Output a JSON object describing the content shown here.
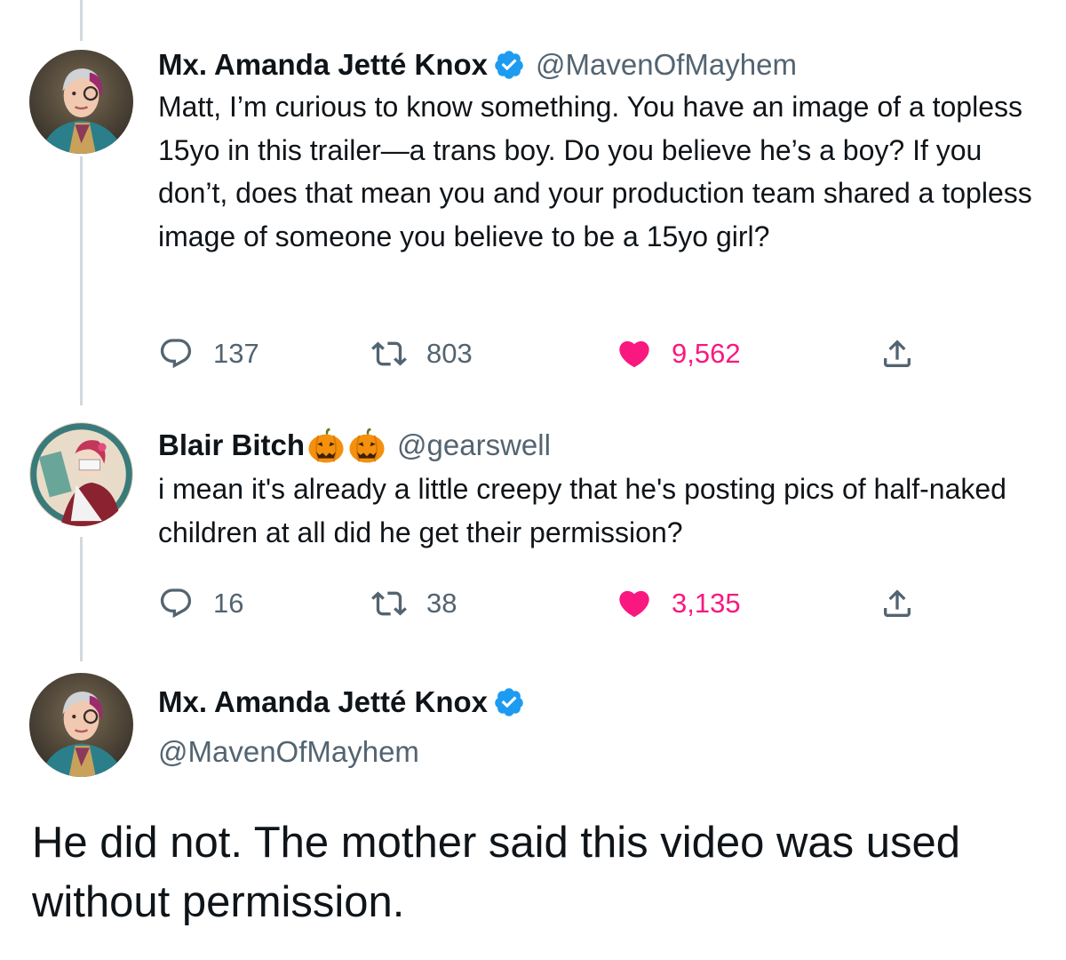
{
  "thread": [
    {
      "author": {
        "display_name": "Mx. Amanda Jetté Knox",
        "handle": "@MavenOfMayhem",
        "verified": true,
        "avatar_icon": "avatar-photo"
      },
      "text": "Matt, I’m curious to know something. You have an image of a topless 15yo in this trailer—a trans boy. Do you believe he’s a boy? If you don’t, does that mean you and your production team shared a topless image of someone you believe to be a 15yo girl?",
      "stats": {
        "replies": "137",
        "retweets": "803",
        "likes": "9,562"
      }
    },
    {
      "author": {
        "display_name": "Blair Bitch",
        "name_emoji": [
          "jack-o-lantern-icon",
          "jack-o-lantern-icon"
        ],
        "handle": "@gearswell",
        "verified": false,
        "avatar_icon": "avatar-illustration"
      },
      "text": "i mean it's already a little creepy that he's posting pics of half-naked children at all did he get their permission?",
      "stats": {
        "replies": "16",
        "retweets": "38",
        "likes": "3,135"
      }
    }
  ],
  "main_tweet": {
    "author": {
      "display_name": "Mx. Amanda Jetté Knox",
      "handle": "@MavenOfMayhem",
      "verified": true,
      "avatar_icon": "avatar-photo"
    },
    "text": "He did not. The mother said this video was used without permission."
  },
  "colors": {
    "text_primary": "#0f1419",
    "text_secondary": "#536471",
    "verified_blue": "#1d9bf0",
    "like_pink": "#f91880",
    "thread_line": "#cfd9de"
  }
}
